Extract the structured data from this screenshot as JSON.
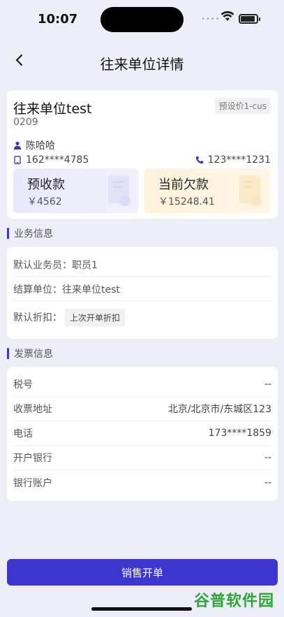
{
  "status": {
    "time": "10:07"
  },
  "nav": {
    "title": "往来单位详情",
    "back_icon": "chevron-left-icon"
  },
  "company": {
    "name": "往来单位test",
    "code": "0209",
    "price_tag": "预设价1-cus",
    "contact_name": "陈哈哈",
    "mobile": "162****4785",
    "phone": "123****1231"
  },
  "balance": {
    "prepaid_label": "预收款",
    "prepaid_value": "￥4562",
    "debt_label": "当前欠款",
    "debt_value": "￥15248.41"
  },
  "business": {
    "section_title": "业务信息",
    "salesman": "默认业务员：职员1",
    "settlement": "结算单位：往来单位test",
    "discount_label": "默认折扣：",
    "discount_value": "上次开单折扣"
  },
  "invoice": {
    "section_title": "发票信息",
    "rows": [
      {
        "label": "税号",
        "value": "--"
      },
      {
        "label": "收票地址",
        "value": "北京/北京市/东城区123"
      },
      {
        "label": "电话",
        "value": "173****1859"
      },
      {
        "label": "开户银行",
        "value": "--"
      },
      {
        "label": "银行账户",
        "value": "--"
      }
    ]
  },
  "actions": {
    "sell_button": "销售开单"
  },
  "watermark": "谷普软件园",
  "colors": {
    "accent": "#3d37cf",
    "background": "#eeeef9",
    "prepaid_bg": "#e9e9fc",
    "debt_bg": "#fdf2da"
  }
}
